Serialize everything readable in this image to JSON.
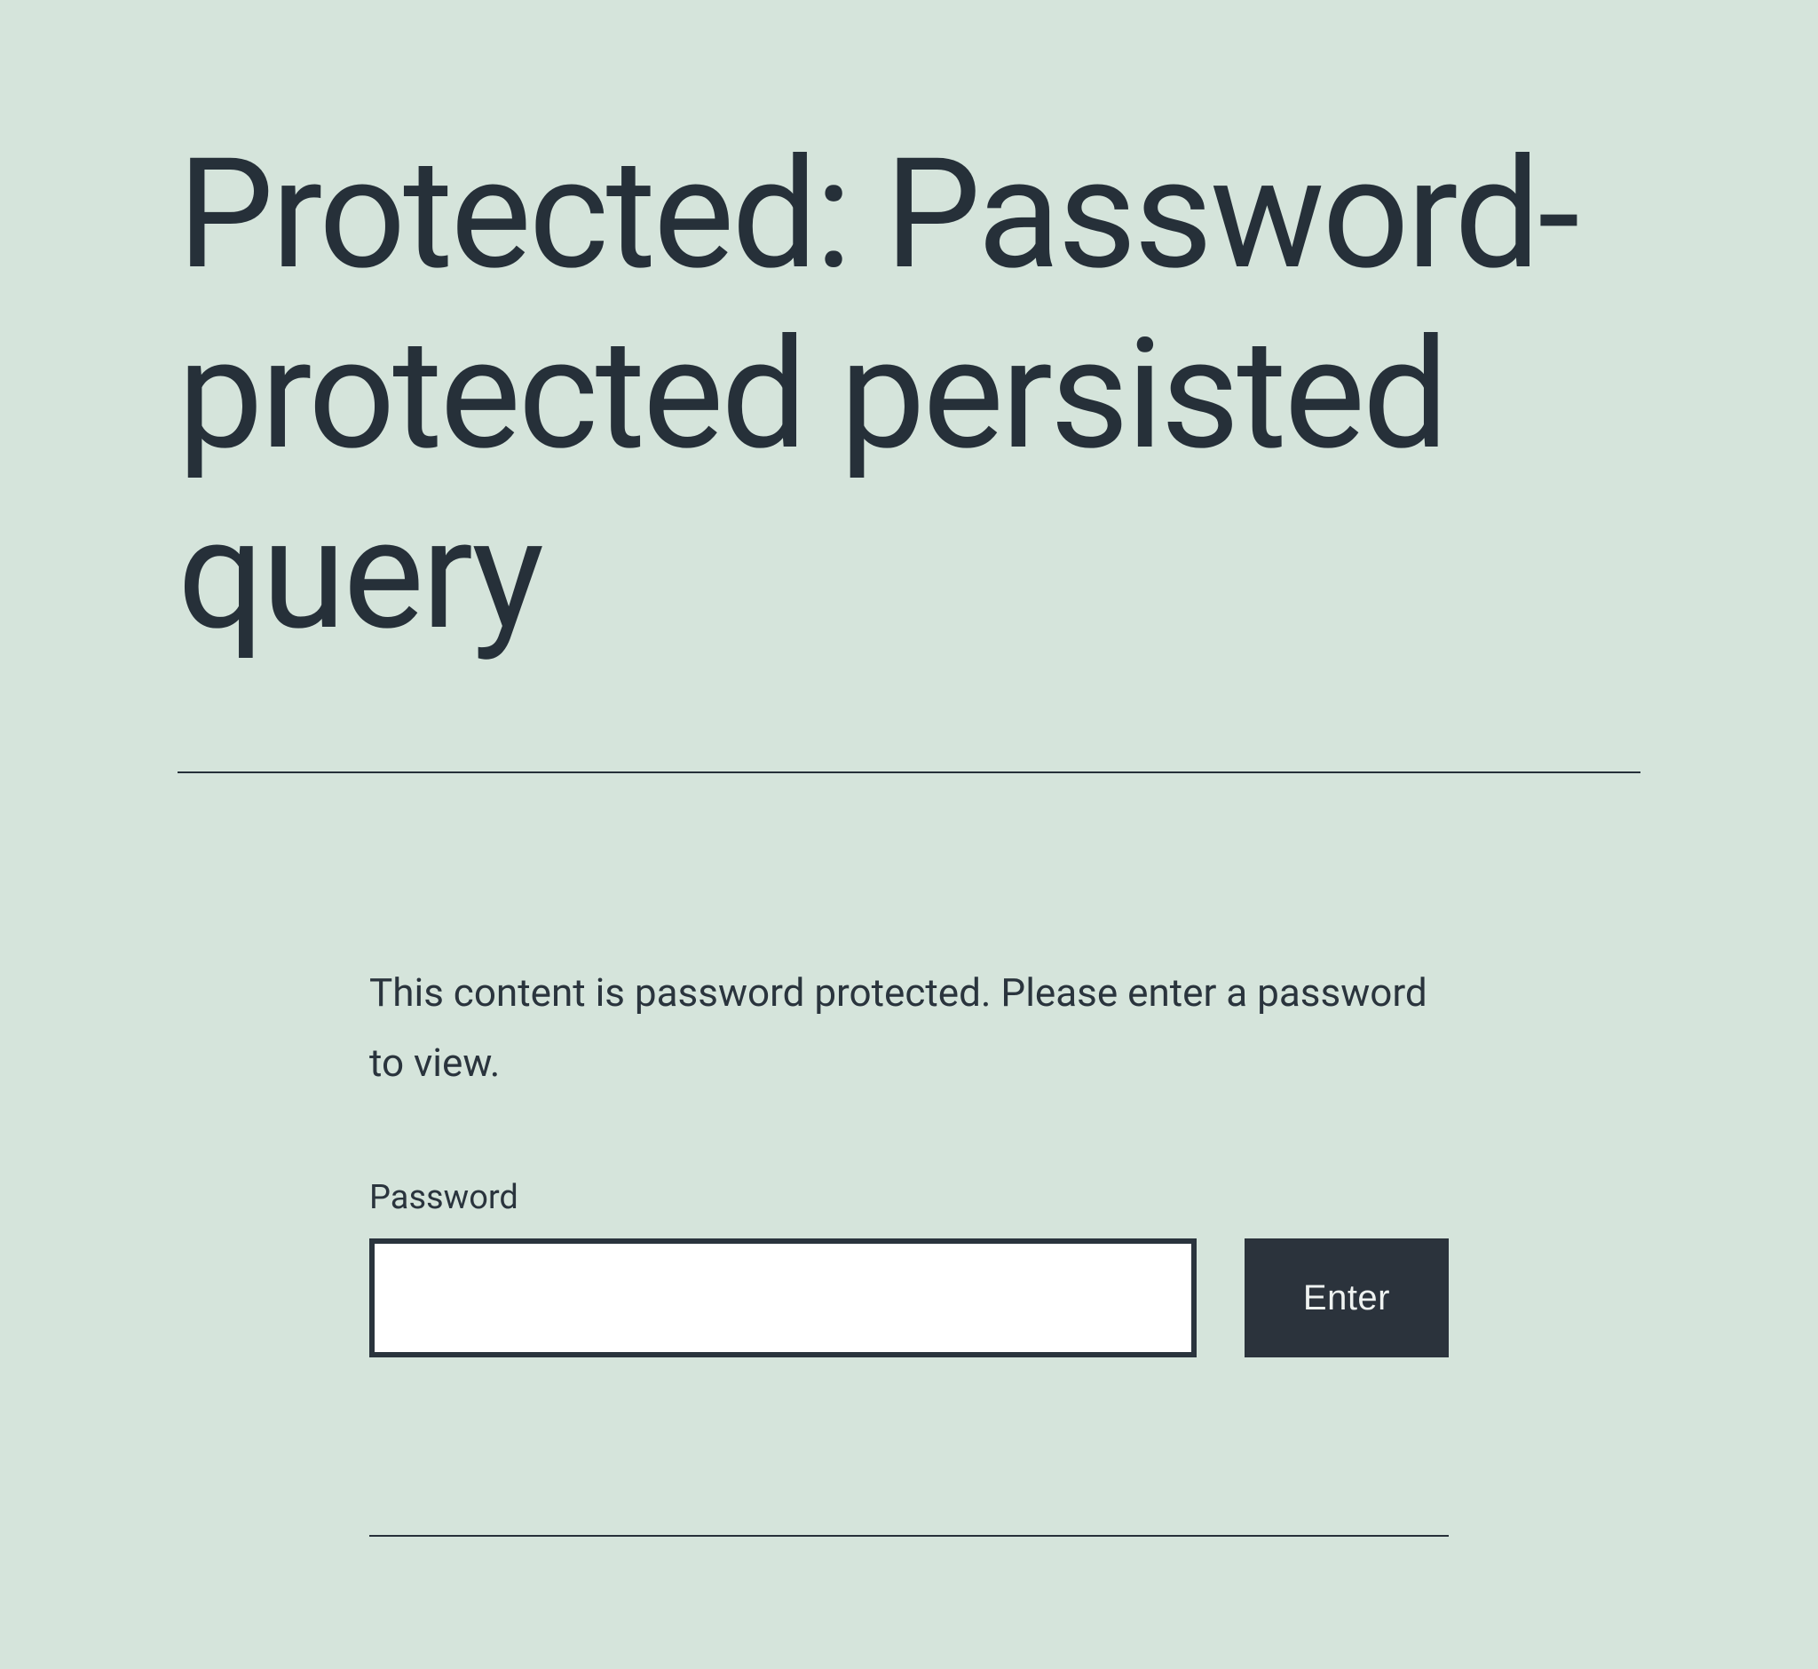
{
  "header": {
    "title": "Protected: Password-protected persisted query"
  },
  "body": {
    "description": "This content is password protected. Please enter a password to view.",
    "password_label": "Password",
    "password_value": "",
    "enter_label": "Enter"
  }
}
